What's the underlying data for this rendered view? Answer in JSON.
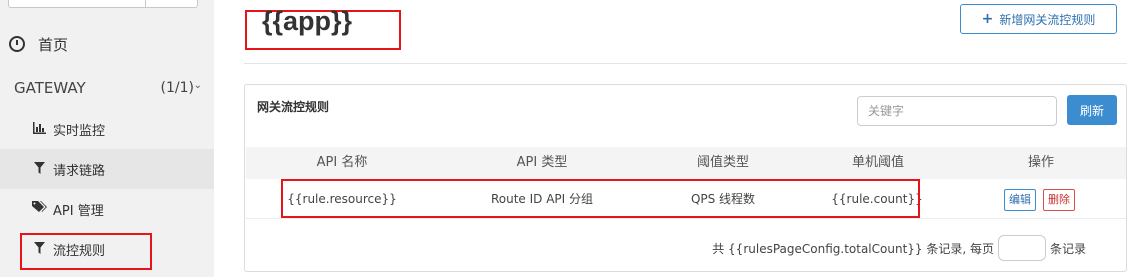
{
  "sidebar": {
    "home_label": "首页",
    "gateway_label": "GATEWAY",
    "gateway_count": "(1/1)",
    "items": [
      {
        "label": "实时监控",
        "icon": "bar-chart-icon"
      },
      {
        "label": "请求链路",
        "icon": "filter-icon"
      },
      {
        "label": "API 管理",
        "icon": "tags-icon"
      },
      {
        "label": "流控规则",
        "icon": "filter-icon"
      }
    ]
  },
  "header": {
    "title": "{{app}}",
    "add_button": "新增网关流控规则"
  },
  "panel": {
    "title": "网关流控规则",
    "search_placeholder": "关键字",
    "refresh_label": "刷新",
    "columns": [
      "API 名称",
      "API 类型",
      "阈值类型",
      "单机阈值",
      "操作"
    ],
    "rows": [
      {
        "resource": "{{rule.resource}}",
        "api_type": "Route ID API 分组",
        "threshold_type": "QPS 线程数",
        "count": "{{rule.count}}",
        "edit_label": "编辑",
        "delete_label": "删除"
      }
    ],
    "footer_prefix": "共 {{rulesPageConfig.totalCount}} 条记录, 每页",
    "footer_suffix": "条记录"
  },
  "colors": {
    "accent": "#3c8dd0",
    "highlight_box": "#e8141c",
    "delete": "#d9534f",
    "sidebar_bg": "#f1f1f1"
  }
}
